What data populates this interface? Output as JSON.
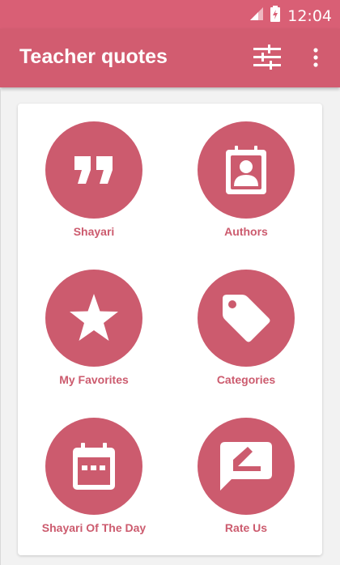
{
  "status_bar": {
    "time": "12:04",
    "icons": [
      "signal-icon",
      "battery-icon"
    ]
  },
  "app_bar": {
    "title": "Teacher quotes",
    "actions": [
      "filter-settings-icon",
      "more-vert-icon"
    ]
  },
  "menu": {
    "items": [
      {
        "label": "Shayari",
        "icon": "quote-icon"
      },
      {
        "label": "Authors",
        "icon": "contact-card-icon"
      },
      {
        "label": "My Favorites",
        "icon": "star-icon"
      },
      {
        "label": "Categories",
        "icon": "tag-icon"
      },
      {
        "label": "Shayari Of The Day",
        "icon": "calendar-icon"
      },
      {
        "label": "Rate Us",
        "icon": "rate-feedback-icon"
      }
    ]
  },
  "colors": {
    "primary": "#d25c70",
    "status_bar": "#d95f75",
    "accent": "#cc5b6e",
    "background": "#f2f2f2"
  }
}
